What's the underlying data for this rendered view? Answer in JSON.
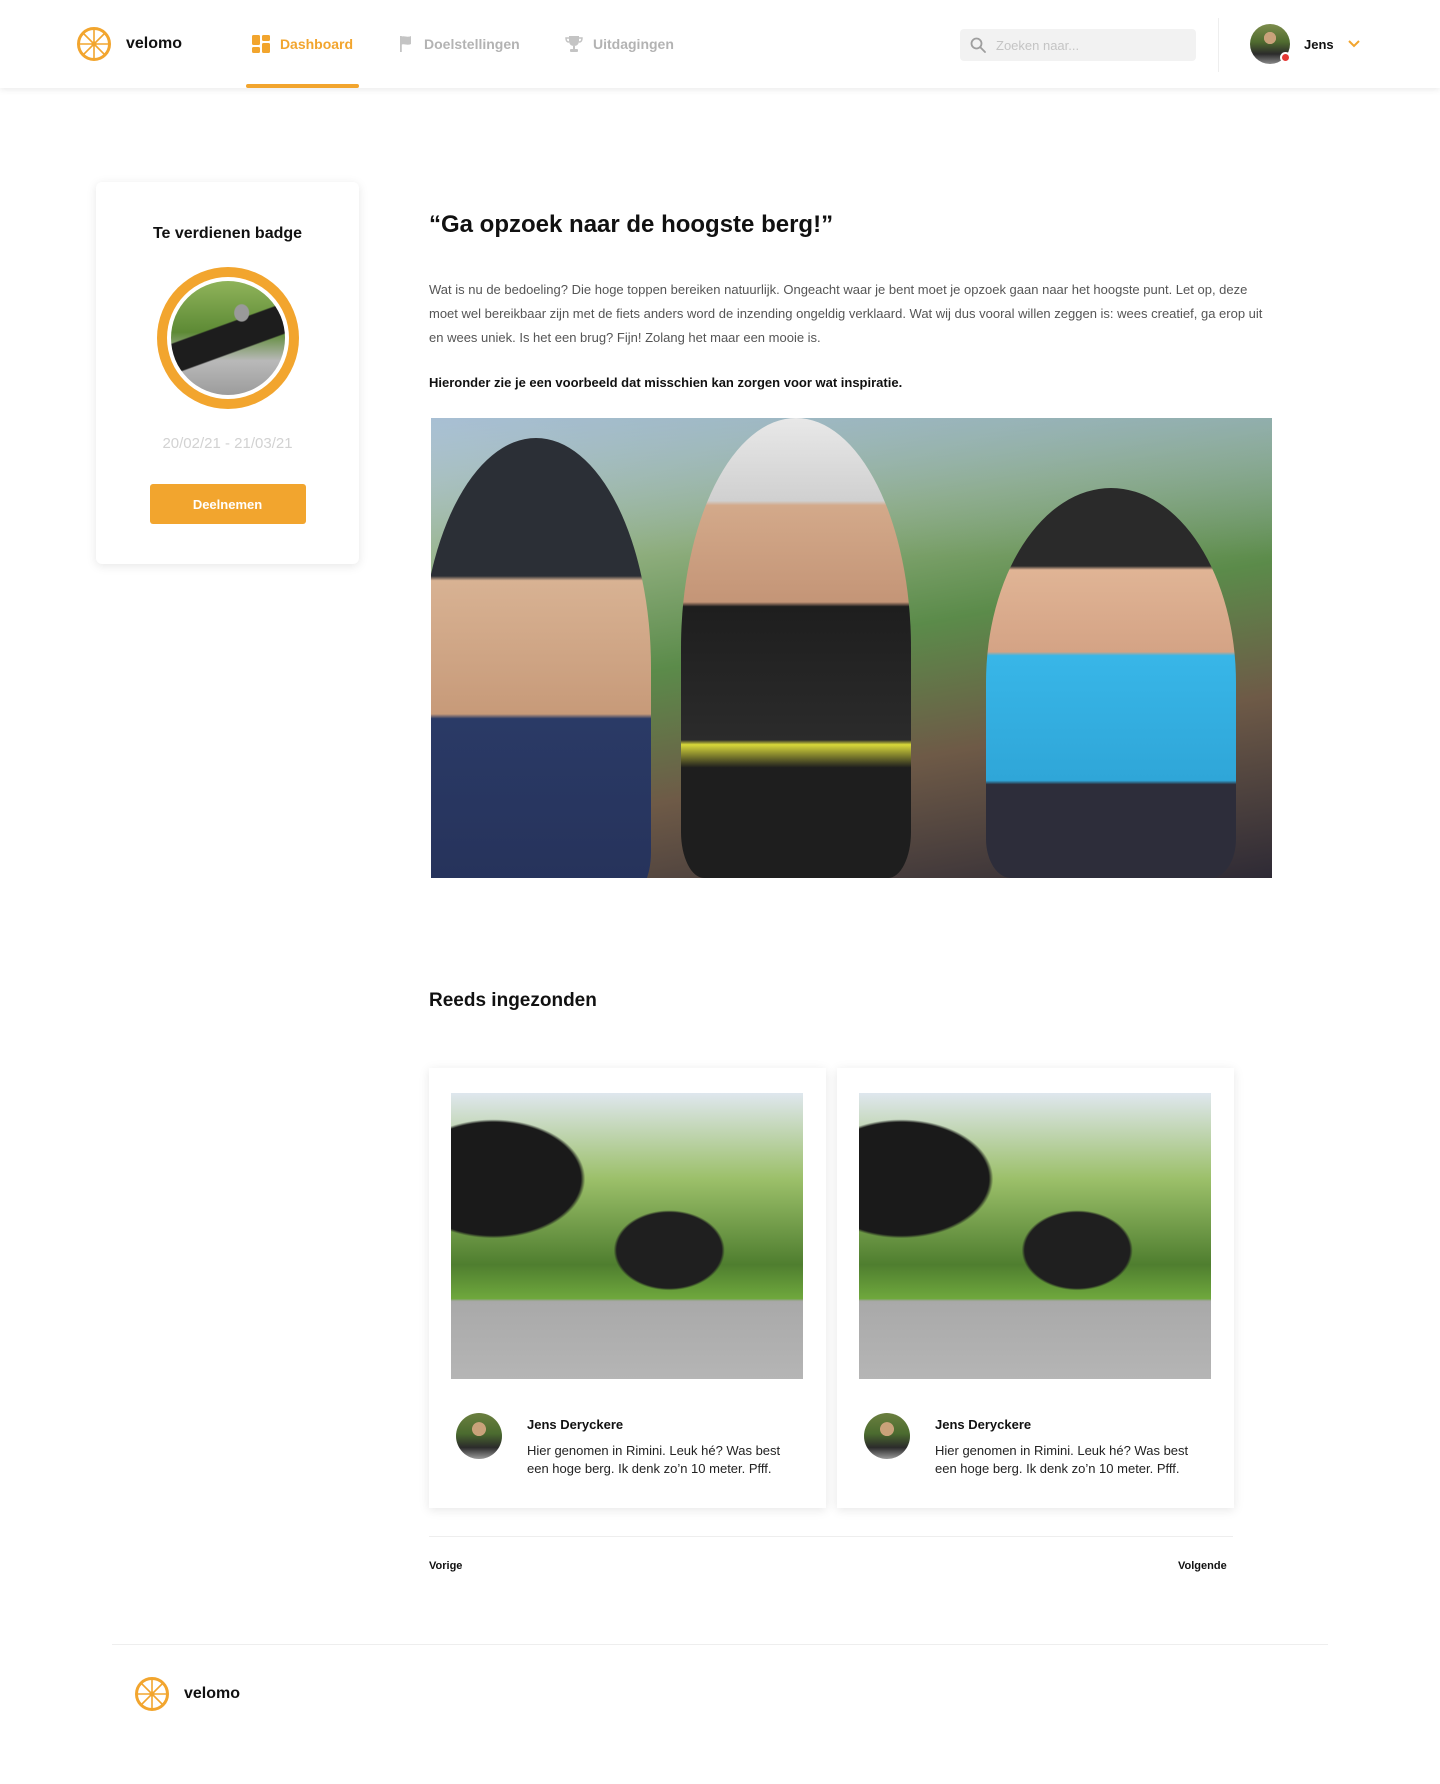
{
  "brand": {
    "name": "velomo",
    "accent": "#f2a52e"
  },
  "nav": {
    "items": [
      {
        "label": "Dashboard",
        "icon": "dashboard-icon",
        "active": true
      },
      {
        "label": "Doelstellingen",
        "icon": "target-icon",
        "active": false
      },
      {
        "label": "Uitdagingen",
        "icon": "trophy-icon",
        "active": false
      }
    ],
    "search_placeholder": "Zoeken naar...",
    "user_name": "Jens"
  },
  "badge_card": {
    "title": "Te verdienen badge",
    "dates": "20/02/21 - 21/03/21",
    "join_label": "Deelnemen"
  },
  "challenge": {
    "title": "“Ga opzoek naar de hoogste berg!”",
    "description": "Wat is nu de bedoeling? Die hoge toppen bereiken natuurlijk. Ongeacht waar je bent moet je opzoek gaan naar het hoogste punt. Let op, deze moet wel bereikbaar zijn met de fiets anders word de inzending ongeldig verklaard. Wat wij dus vooral willen zeggen is: wees creatief, ga erop uit en wees uniek. Is het een brug? Fijn! Zolang het maar een mooie is.",
    "hint": "Hieronder zie je een voorbeeld dat misschien kan zorgen voor wat inspiratie."
  },
  "submissions": {
    "title": "Reeds ingezonden",
    "items": [
      {
        "author": "Jens Deryckere",
        "text": "Hier genomen in Rimini. Leuk hé? Was best een hoge berg. Ik denk zo’n 10 meter. Pfff."
      },
      {
        "author": "Jens Deryckere",
        "text": "Hier genomen in Rimini. Leuk hé? Was best een hoge berg. Ik denk zo’n 10 meter. Pfff."
      }
    ],
    "prev_label": "Vorige",
    "next_label": "Volgende"
  },
  "footer": {
    "brand": "velomo"
  }
}
